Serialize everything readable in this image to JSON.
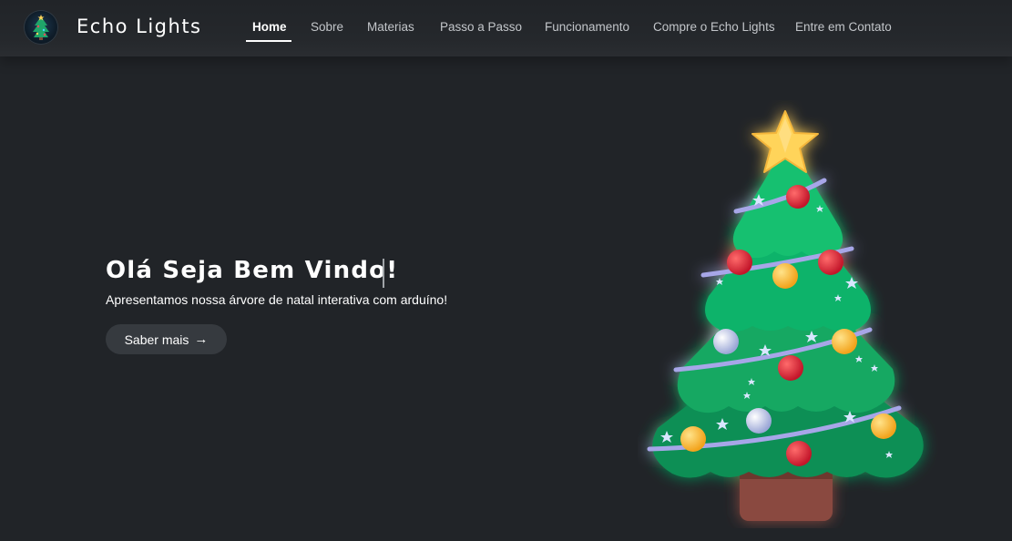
{
  "brand": {
    "name": "Echo Lights",
    "logo_icon": "christmas-tree-logo-icon"
  },
  "nav": {
    "items": [
      {
        "label": "Home",
        "active": true
      },
      {
        "label": "Sobre",
        "active": false
      },
      {
        "label": "Materias",
        "active": false
      },
      {
        "label": "Passo a Passo",
        "active": false
      },
      {
        "label": "Funcionamento",
        "active": false
      },
      {
        "label": "Compre o Echo Lights",
        "active": false
      },
      {
        "label": "Entre em Contato",
        "active": false
      }
    ]
  },
  "hero": {
    "title": "Olá Seja Bem Vindo!",
    "subtitle": "Apresentamos nossa árvore de natal interativa com arduíno!",
    "cta_label": "Saber mais",
    "cta_icon": "arrow-right-icon",
    "illustration": "christmas-tree-illustration"
  },
  "colors": {
    "background": "#212428",
    "button": "#363a3f",
    "tree_green": "#0f9f5f",
    "star_yellow": "#ffd45a"
  }
}
